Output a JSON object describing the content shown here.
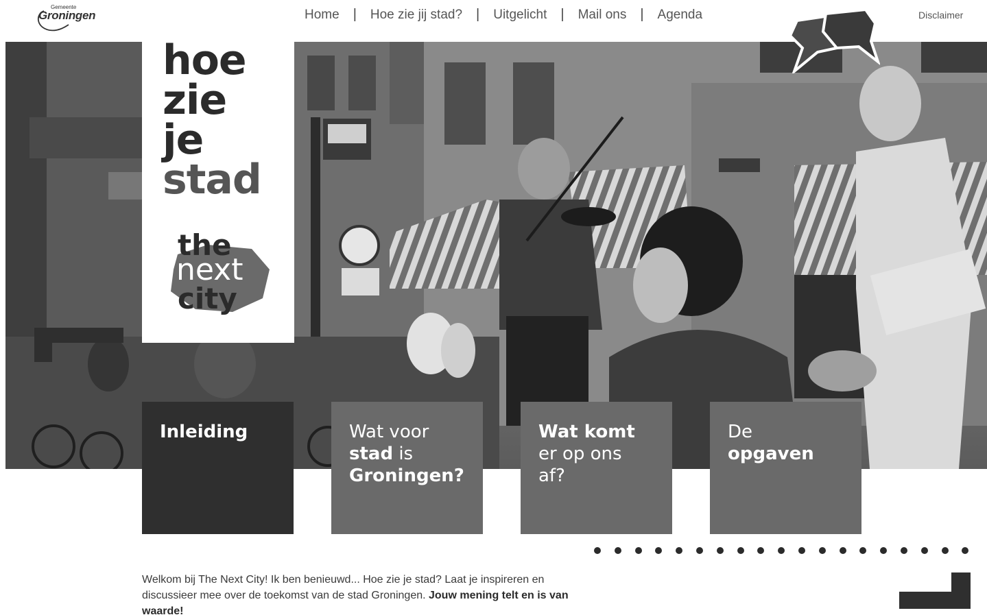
{
  "logo": {
    "small": "Gemeente",
    "big": "Groningen"
  },
  "nav": [
    {
      "label": "Home"
    },
    {
      "label": "Hoe zie jij stad?"
    },
    {
      "label": "Uitgelicht"
    },
    {
      "label": "Mail ons"
    },
    {
      "label": "Agenda"
    }
  ],
  "nav_separator": "|",
  "disclaimer": "Disclaimer",
  "hero": {
    "title_words": [
      "hoe",
      "zie",
      "je",
      "stad"
    ],
    "next_city": [
      "the",
      "next",
      "city"
    ]
  },
  "tiles": [
    {
      "parts": [
        {
          "t": "Inleiding",
          "bold": true
        }
      ]
    },
    {
      "parts": [
        {
          "t": "Wat voor",
          "bold": false
        },
        {
          "t": "stad",
          "bold": true
        },
        {
          "t": " is",
          "bold": false
        },
        {
          "t": "Groningen?",
          "bold": true
        }
      ]
    },
    {
      "parts": [
        {
          "t": "Wat komt",
          "bold": true
        },
        {
          "t": "er op ons",
          "bold": false
        },
        {
          "t": "af?",
          "bold": false
        }
      ]
    },
    {
      "parts": [
        {
          "t": "De",
          "bold": false
        },
        {
          "t": "opgaven",
          "bold": true
        }
      ]
    }
  ],
  "intro": {
    "text": "Welkom bij The Next City! Ik ben benieuwd... Hoe zie je stad? Laat je inspireren en discussieer mee over de toekomst van de stad Groningen. ",
    "bold": "Jouw mening telt en is van waarde!"
  },
  "colors": {
    "dark_tile": "#2f2f2f",
    "mid_tile": "#6a6a6a",
    "text": "#2b2b2b"
  }
}
